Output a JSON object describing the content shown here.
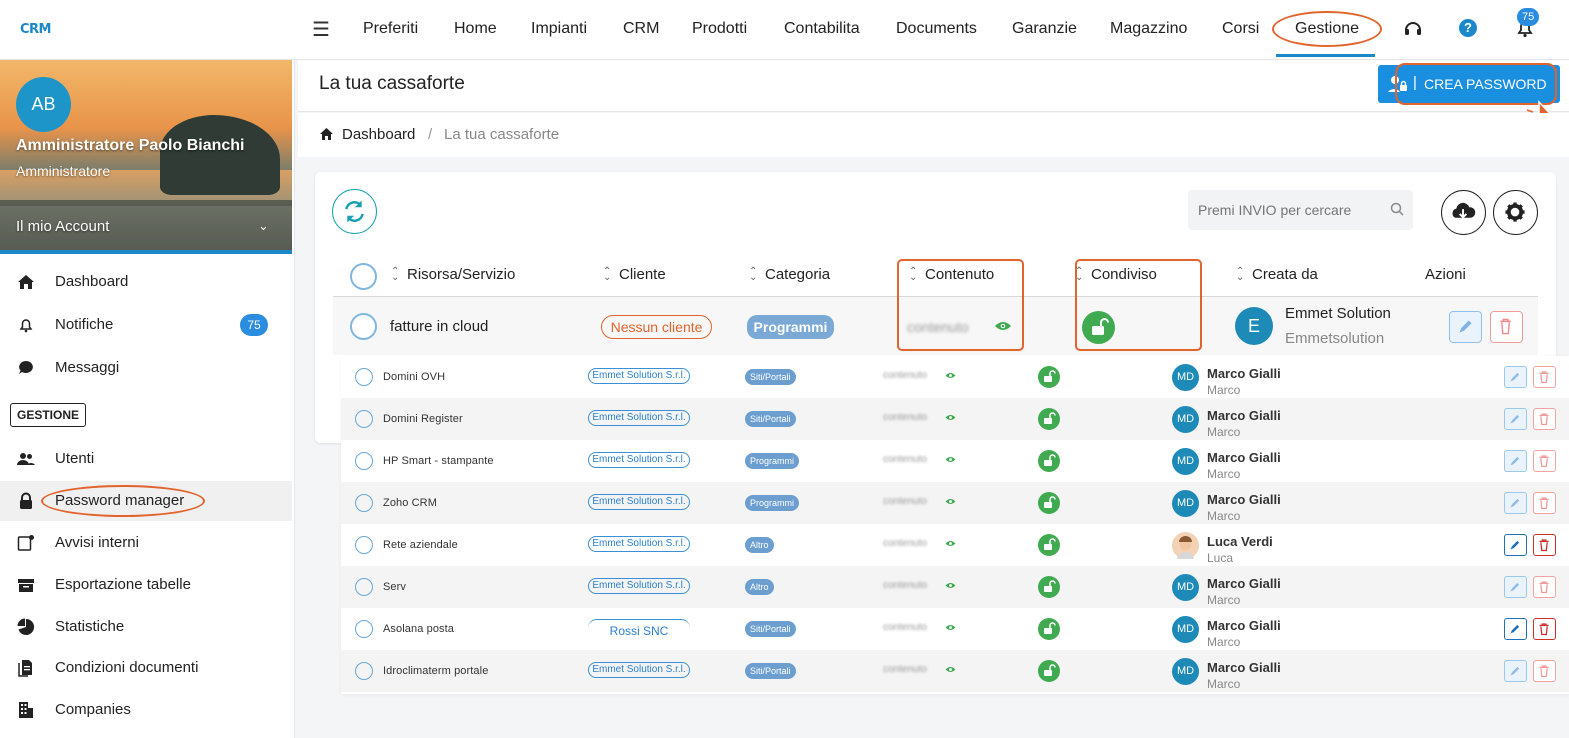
{
  "app": {
    "logo": "CRM"
  },
  "nav": {
    "items": [
      "Preferiti",
      "Home",
      "Impianti",
      "CRM",
      "Prodotti",
      "Contabilita",
      "Documents",
      "Garanzie",
      "Magazzino",
      "Corsi",
      "Gestione"
    ],
    "active": "Gestione",
    "notification_count": "75",
    "help_label": "?"
  },
  "sidebar": {
    "avatar_initials": "AB",
    "user_name": "Amministratore Paolo Bianchi",
    "user_role": "Amministratore",
    "account_label": "Il mio Account",
    "items_top": [
      {
        "label": "Dashboard",
        "icon": "home-icon"
      },
      {
        "label": "Notifiche",
        "icon": "bell-icon",
        "badge": "75"
      },
      {
        "label": "Messaggi",
        "icon": "chat-icon"
      }
    ],
    "section_label": "GESTIONE",
    "items_gestione": [
      {
        "label": "Utenti",
        "icon": "users-icon"
      },
      {
        "label": "Password manager",
        "icon": "lock-icon"
      },
      {
        "label": "Avvisi interni",
        "icon": "alert-icon"
      },
      {
        "label": "Esportazione tabelle",
        "icon": "archive-icon"
      },
      {
        "label": "Statistiche",
        "icon": "pie-chart-icon"
      },
      {
        "label": "Condizioni documenti",
        "icon": "documents-icon"
      },
      {
        "label": "Companies",
        "icon": "building-icon"
      }
    ]
  },
  "page": {
    "title": "La tua cassaforte",
    "create_button": "CREA PASSWORD",
    "breadcrumb": {
      "home": "Dashboard",
      "separator": "/",
      "current": "La tua cassaforte"
    }
  },
  "table": {
    "search_placeholder": "Premi INVIO per cercare",
    "columns": [
      "Risorsa/Servizio",
      "Cliente",
      "Categoria",
      "Contenuto",
      "Condiviso",
      "Creata da",
      "Azioni"
    ],
    "main_row": {
      "resource": "fatture in cloud",
      "client": "Nessun cliente",
      "category": "Programmi",
      "content": "contenuto",
      "creator_initial": "E",
      "creator_name": "Emmet Solution",
      "creator_user": "Emmetsolution"
    },
    "rows": [
      {
        "resource": "Domini OVH",
        "client": "Emmet Solution S.r.l.",
        "category": "Siti/Portali",
        "content": "contenuto",
        "initials": "MD",
        "creator_name": "Marco Gialli",
        "creator_user": "Marco",
        "actions_enabled": false
      },
      {
        "resource": "Domini Register",
        "client": "Emmet Solution S.r.l.",
        "category": "Siti/Portali",
        "content": "contenuto",
        "initials": "MD",
        "creator_name": "Marco Gialli",
        "creator_user": "Marco",
        "actions_enabled": false
      },
      {
        "resource": "HP Smart - stampante",
        "client": "Emmet Solution S.r.l.",
        "category": "Programmi",
        "content": "contenuto",
        "initials": "MD",
        "creator_name": "Marco Gialli",
        "creator_user": "Marco",
        "actions_enabled": false
      },
      {
        "resource": "Zoho CRM",
        "client": "Emmet Solution S.r.l.",
        "category": "Programmi",
        "content": "contenuto",
        "initials": "MD",
        "creator_name": "Marco Gialli",
        "creator_user": "Marco",
        "actions_enabled": false
      },
      {
        "resource": "Rete aziendale",
        "client": "Emmet Solution S.r.l.",
        "category": "Altro",
        "content": "contenuto",
        "initials": "",
        "creator_name": "Luca Verdi",
        "creator_user": "Luca",
        "actions_enabled": true
      },
      {
        "resource": "Serv",
        "client": "Emmet Solution S.r.l.",
        "category": "Altro",
        "content": "contenuto",
        "initials": "MD",
        "creator_name": "Marco Gialli",
        "creator_user": "Marco",
        "actions_enabled": false
      },
      {
        "resource": "Asolana posta",
        "client": "Rossi SNC",
        "category": "Siti/Portali",
        "content": "contenuto",
        "initials": "MD",
        "creator_name": "Marco Gialli",
        "creator_user": "Marco",
        "actions_enabled": true
      },
      {
        "resource": "Idroclimaterm portale",
        "client": "Emmet Solution S.r.l.",
        "category": "Siti/Portali",
        "content": "contenuto",
        "initials": "MD",
        "creator_name": "Marco Gialli",
        "creator_user": "Marco",
        "actions_enabled": false
      }
    ]
  },
  "colors": {
    "accent": "#1a88c9",
    "highlight": "#e1642c",
    "shared": "#3faa4f"
  }
}
